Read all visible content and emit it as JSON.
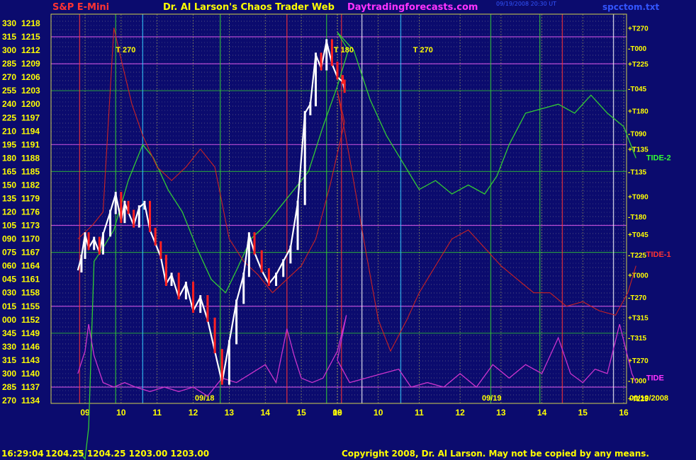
{
  "header": {
    "instrument": "S&P E-Mini",
    "title": "Dr. Al Larson's Chaos Trader Web",
    "site": "Daytradingforecasts.com",
    "timestamp": "09/19/2008 20:30 UT",
    "file": "spcctom.txt"
  },
  "footer": {
    "quote_time": "16:29:04",
    "quote_values": "1204.25 1204.25 1203.00 1203.00",
    "copyright": "Copyright 2008, Dr. Al Larson. May not be copied by any means."
  },
  "colors": {
    "background": "#0b0b6e",
    "text_yellow": "#ffff00",
    "title_magenta": "#ff33ff",
    "instrument_red": "#ff3333",
    "price_up": "#ffffff",
    "price_down": "#ff2020",
    "flux_green": "#33cc33",
    "flux_red": "#cc2222",
    "tide_magenta": "#cc33cc"
  },
  "chart_data": {
    "type": "line",
    "title": "S&P E-Mini",
    "ylim": [
      1133,
      1220
    ],
    "y_ticks": [
      {
        "angle": "330",
        "price": 1218
      },
      {
        "angle": "315",
        "price": 1215
      },
      {
        "angle": "300",
        "price": 1212
      },
      {
        "angle": "285",
        "price": 1209
      },
      {
        "angle": "270",
        "price": 1206
      },
      {
        "angle": "255",
        "price": 1203
      },
      {
        "angle": "240",
        "price": 1200
      },
      {
        "angle": "225",
        "price": 1197
      },
      {
        "angle": "210",
        "price": 1194
      },
      {
        "angle": "195",
        "price": 1191
      },
      {
        "angle": "180",
        "price": 1188
      },
      {
        "angle": "165",
        "price": 1185
      },
      {
        "angle": "150",
        "price": 1182
      },
      {
        "angle": "135",
        "price": 1179
      },
      {
        "angle": "120",
        "price": 1176
      },
      {
        "angle": "105",
        "price": 1173
      },
      {
        "angle": "090",
        "price": 1170
      },
      {
        "angle": "075",
        "price": 1167
      },
      {
        "angle": "060",
        "price": 1164
      },
      {
        "angle": "045",
        "price": 1161
      },
      {
        "angle": "030",
        "price": 1158
      },
      {
        "angle": "015",
        "price": 1155
      },
      {
        "angle": "000",
        "price": 1152
      },
      {
        "angle": "345",
        "price": 1149
      },
      {
        "angle": "330",
        "price": 1146
      },
      {
        "angle": "315",
        "price": 1143
      },
      {
        "angle": "300",
        "price": 1140
      },
      {
        "angle": "285",
        "price": 1137
      },
      {
        "angle": "270",
        "price": 1134
      }
    ],
    "x_hour_labels": [
      "09",
      "10",
      "11",
      "12",
      "13",
      "14",
      "15",
      "16",
      "09",
      "10",
      "11",
      "12",
      "13",
      "14",
      "15",
      "16"
    ],
    "date_labels": [
      "09/18",
      "09/19",
      "09/19/2008"
    ],
    "right_labels": [
      {
        "text": "+T270",
        "price": 1217
      },
      {
        "text": "-T000",
        "price": 1212.5
      },
      {
        "text": "+T225",
        "price": 1209
      },
      {
        "text": "-T045",
        "price": 1203.5
      },
      {
        "text": "+T180",
        "price": 1198.5
      },
      {
        "text": "-T090",
        "price": 1193.5
      },
      {
        "text": "+T135",
        "price": 1190
      },
      {
        "text": "-T135",
        "price": 1185
      },
      {
        "text": "+T090",
        "price": 1179.5
      },
      {
        "text": "-T180",
        "price": 1175
      },
      {
        "text": "+T045",
        "price": 1171
      },
      {
        "text": "-T225",
        "price": 1166.5
      },
      {
        "text": "+T000",
        "price": 1162
      },
      {
        "text": "-T270",
        "price": 1157
      },
      {
        "text": "+T315",
        "price": 1152.5
      },
      {
        "text": "-T315",
        "price": 1148
      },
      {
        "text": "+T270",
        "price": 1143
      },
      {
        "text": "-T000",
        "price": 1138.5
      },
      {
        "text": "+T225",
        "price": 1134.5
      }
    ],
    "chart_labels": [
      {
        "text": "T 270",
        "day": 0,
        "hour": 9.85,
        "price": 1211.5,
        "color": "#ffff00"
      },
      {
        "text": "T 180",
        "day": 0,
        "hour": 15.9,
        "price": 1211.5,
        "color": "#ffff00"
      },
      {
        "text": "T 270",
        "day": 1,
        "hour": 10.85,
        "price": 1211.5,
        "color": "#ffff00"
      },
      {
        "text": "TIDE-2",
        "day": 1,
        "hour": 16.55,
        "price": 1187.5,
        "color": "#33ff33"
      },
      {
        "text": "TIDE-1",
        "day": 1,
        "hour": 16.55,
        "price": 1166,
        "color": "#ff3333"
      },
      {
        "text": "TIDE",
        "day": 1,
        "hour": 16.55,
        "price": 1138.5,
        "color": "#ff33ff"
      }
    ],
    "series": [
      {
        "name": "S&P E-Mini price",
        "color": "#ffffff",
        "points": [
          [
            0,
            8.8,
            1163
          ],
          [
            0,
            8.9,
            1166
          ],
          [
            0,
            9.0,
            1171
          ],
          [
            0,
            9.1,
            1168
          ],
          [
            0,
            9.25,
            1170
          ],
          [
            0,
            9.4,
            1167
          ],
          [
            0,
            9.5,
            1171
          ],
          [
            0,
            9.7,
            1176
          ],
          [
            0,
            9.85,
            1180
          ],
          [
            0,
            10.0,
            1174
          ],
          [
            0,
            10.1,
            1178
          ],
          [
            0,
            10.2,
            1176
          ],
          [
            0,
            10.35,
            1173
          ],
          [
            0,
            10.5,
            1177
          ],
          [
            0,
            10.65,
            1178
          ],
          [
            0,
            10.8,
            1172
          ],
          [
            0,
            10.95,
            1169
          ],
          [
            0,
            11.1,
            1166
          ],
          [
            0,
            11.25,
            1160
          ],
          [
            0,
            11.4,
            1162
          ],
          [
            0,
            11.6,
            1157
          ],
          [
            0,
            11.8,
            1160
          ],
          [
            0,
            12.0,
            1154
          ],
          [
            0,
            12.2,
            1157
          ],
          [
            0,
            12.4,
            1152
          ],
          [
            0,
            12.6,
            1145
          ],
          [
            0,
            12.8,
            1138
          ],
          [
            0,
            13.0,
            1147
          ],
          [
            0,
            13.2,
            1156
          ],
          [
            0,
            13.4,
            1162
          ],
          [
            0,
            13.55,
            1171
          ],
          [
            0,
            13.7,
            1167
          ],
          [
            0,
            13.9,
            1163
          ],
          [
            0,
            14.1,
            1160
          ],
          [
            0,
            14.3,
            1162
          ],
          [
            0,
            14.5,
            1165
          ],
          [
            0,
            14.7,
            1168
          ],
          [
            0,
            14.9,
            1178
          ],
          [
            0,
            15.1,
            1198
          ],
          [
            0,
            15.25,
            1200
          ],
          [
            0,
            15.4,
            1211
          ],
          [
            0,
            15.55,
            1208
          ],
          [
            0,
            15.7,
            1214
          ],
          [
            0,
            15.85,
            1209
          ],
          [
            0,
            16.0,
            1206
          ],
          [
            0,
            16.15,
            1205
          ],
          [
            0,
            16.2,
            1203
          ]
        ]
      },
      {
        "name": "Flux line green",
        "color": "#33cc33",
        "points": [
          [
            0,
            8.8,
            1123
          ],
          [
            0,
            9.0,
            1121
          ],
          [
            0,
            9.1,
            1128
          ],
          [
            0,
            9.25,
            1165
          ],
          [
            0,
            9.5,
            1168
          ],
          [
            0,
            9.8,
            1172
          ],
          [
            0,
            10.2,
            1183
          ],
          [
            0,
            10.6,
            1191
          ],
          [
            0,
            10.9,
            1188
          ],
          [
            0,
            11.3,
            1181
          ],
          [
            0,
            11.7,
            1176
          ],
          [
            0,
            12.1,
            1168
          ],
          [
            0,
            12.5,
            1161
          ],
          [
            0,
            12.9,
            1158
          ],
          [
            0,
            13.2,
            1163
          ],
          [
            0,
            13.6,
            1170
          ],
          [
            0,
            14.0,
            1173
          ],
          [
            0,
            14.4,
            1177
          ],
          [
            0,
            14.8,
            1181
          ],
          [
            0,
            15.2,
            1185
          ],
          [
            0,
            15.6,
            1195
          ],
          [
            0,
            16.0,
            1204
          ],
          [
            0,
            16.3,
            1212
          ],
          [
            1,
            9.0,
            1216
          ],
          [
            1,
            9.4,
            1212
          ],
          [
            1,
            9.8,
            1201
          ],
          [
            1,
            10.2,
            1193
          ],
          [
            1,
            10.6,
            1187
          ],
          [
            1,
            11.0,
            1181
          ],
          [
            1,
            11.4,
            1183
          ],
          [
            1,
            11.8,
            1180
          ],
          [
            1,
            12.2,
            1182
          ],
          [
            1,
            12.6,
            1180
          ],
          [
            1,
            12.9,
            1184
          ],
          [
            1,
            13.2,
            1191
          ],
          [
            1,
            13.6,
            1198
          ],
          [
            1,
            14.0,
            1199
          ],
          [
            1,
            14.4,
            1200
          ],
          [
            1,
            14.8,
            1198
          ],
          [
            1,
            15.2,
            1202
          ],
          [
            1,
            15.6,
            1198
          ],
          [
            1,
            16.0,
            1195
          ],
          [
            1,
            16.3,
            1188
          ]
        ]
      },
      {
        "name": "Flux line red",
        "color": "#cc2222",
        "points": [
          [
            0,
            8.8,
            1170
          ],
          [
            0,
            9.2,
            1173
          ],
          [
            0,
            9.5,
            1176
          ],
          [
            0,
            9.8,
            1217
          ],
          [
            0,
            10.0,
            1210
          ],
          [
            0,
            10.3,
            1200
          ],
          [
            0,
            10.6,
            1193
          ],
          [
            0,
            11.0,
            1186
          ],
          [
            0,
            11.4,
            1183
          ],
          [
            0,
            11.8,
            1186
          ],
          [
            0,
            12.2,
            1190
          ],
          [
            0,
            12.6,
            1186
          ],
          [
            0,
            13.0,
            1170
          ],
          [
            0,
            13.4,
            1165
          ],
          [
            0,
            13.8,
            1162
          ],
          [
            0,
            14.2,
            1158
          ],
          [
            0,
            14.6,
            1161
          ],
          [
            0,
            15.0,
            1164
          ],
          [
            0,
            15.4,
            1170
          ],
          [
            0,
            15.8,
            1182
          ],
          [
            0,
            16.2,
            1196
          ],
          [
            1,
            9.0,
            1203
          ],
          [
            1,
            9.3,
            1188
          ],
          [
            1,
            9.7,
            1167
          ],
          [
            1,
            10.0,
            1152
          ],
          [
            1,
            10.3,
            1145
          ],
          [
            1,
            10.7,
            1152
          ],
          [
            1,
            11.0,
            1158
          ],
          [
            1,
            11.4,
            1164
          ],
          [
            1,
            11.8,
            1170
          ],
          [
            1,
            12.2,
            1172
          ],
          [
            1,
            12.6,
            1168
          ],
          [
            1,
            13.0,
            1164
          ],
          [
            1,
            13.4,
            1161
          ],
          [
            1,
            13.8,
            1158
          ],
          [
            1,
            14.2,
            1158
          ],
          [
            1,
            14.6,
            1155
          ],
          [
            1,
            15.0,
            1156
          ],
          [
            1,
            15.4,
            1154
          ],
          [
            1,
            15.8,
            1153
          ],
          [
            1,
            16.1,
            1158
          ],
          [
            1,
            16.3,
            1164
          ]
        ]
      },
      {
        "name": "Tide",
        "color": "#cc33cc",
        "points": [
          [
            0,
            8.8,
            1140
          ],
          [
            0,
            9.0,
            1145
          ],
          [
            0,
            9.1,
            1151
          ],
          [
            0,
            9.25,
            1144
          ],
          [
            0,
            9.5,
            1138
          ],
          [
            0,
            9.8,
            1137
          ],
          [
            0,
            10.1,
            1138
          ],
          [
            0,
            10.4,
            1137
          ],
          [
            0,
            10.8,
            1136
          ],
          [
            0,
            11.2,
            1137
          ],
          [
            0,
            11.6,
            1136
          ],
          [
            0,
            12.0,
            1137
          ],
          [
            0,
            12.4,
            1135
          ],
          [
            0,
            12.8,
            1139
          ],
          [
            0,
            13.2,
            1138
          ],
          [
            0,
            13.6,
            1140
          ],
          [
            0,
            14.0,
            1142
          ],
          [
            0,
            14.3,
            1138
          ],
          [
            0,
            14.6,
            1150
          ],
          [
            0,
            14.8,
            1144
          ],
          [
            0,
            15.0,
            1139
          ],
          [
            0,
            15.3,
            1138
          ],
          [
            0,
            15.6,
            1139
          ],
          [
            0,
            16.0,
            1145
          ],
          [
            0,
            16.25,
            1153
          ],
          [
            1,
            9.0,
            1143
          ],
          [
            1,
            9.3,
            1138
          ],
          [
            1,
            9.7,
            1139
          ],
          [
            1,
            10.1,
            1140
          ],
          [
            1,
            10.5,
            1141
          ],
          [
            1,
            10.8,
            1137
          ],
          [
            1,
            11.2,
            1138
          ],
          [
            1,
            11.6,
            1137
          ],
          [
            1,
            12.0,
            1140
          ],
          [
            1,
            12.4,
            1137
          ],
          [
            1,
            12.8,
            1142
          ],
          [
            1,
            13.2,
            1139
          ],
          [
            1,
            13.6,
            1142
          ],
          [
            1,
            14.0,
            1140
          ],
          [
            1,
            14.4,
            1148
          ],
          [
            1,
            14.7,
            1140
          ],
          [
            1,
            15.0,
            1138
          ],
          [
            1,
            15.3,
            1141
          ],
          [
            1,
            15.6,
            1140
          ],
          [
            1,
            15.9,
            1151
          ],
          [
            1,
            16.2,
            1140
          ],
          [
            1,
            16.3,
            1138
          ]
        ]
      }
    ]
  }
}
